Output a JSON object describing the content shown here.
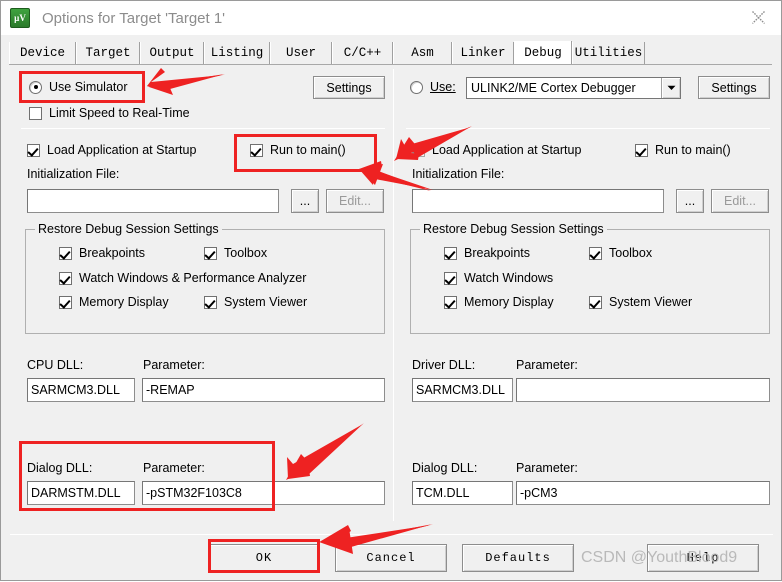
{
  "window": {
    "title": "Options for Target 'Target 1'",
    "app_icon_label": "µV",
    "close_label": "✕"
  },
  "tabs": [
    {
      "label": "Device",
      "active": false
    },
    {
      "label": "Target",
      "active": false
    },
    {
      "label": "Output",
      "active": false
    },
    {
      "label": "Listing",
      "active": false
    },
    {
      "label": "User",
      "active": false
    },
    {
      "label": "C/C++",
      "active": false
    },
    {
      "label": "Asm",
      "active": false
    },
    {
      "label": "Linker",
      "active": false
    },
    {
      "label": "Debug",
      "active": true
    },
    {
      "label": "Utilities",
      "active": false
    }
  ],
  "left": {
    "use_simulator_label": "Use Simulator",
    "use_simulator_checked": true,
    "limit_speed_label": "Limit Speed to Real-Time",
    "limit_speed_checked": false,
    "settings_button": "Settings",
    "load_app_label": "Load Application at Startup",
    "load_app_checked": true,
    "run_to_main_label": "Run to main()",
    "run_to_main_checked": true,
    "init_file_label": "Initialization File:",
    "init_file_value": "",
    "browse_button": "...",
    "edit_button": "Edit...",
    "restore_group_title": "Restore Debug Session Settings",
    "restore_items": [
      {
        "label": "Breakpoints",
        "checked": true
      },
      {
        "label": "Toolbox",
        "checked": true
      },
      {
        "label": "Watch Windows & Performance Analyzer",
        "checked": true
      },
      {
        "label": "Memory Display",
        "checked": true
      },
      {
        "label": "System Viewer",
        "checked": true
      }
    ],
    "cpu_dll_label": "CPU DLL:",
    "cpu_dll_value": "SARMCM3.DLL",
    "cpu_param_label": "Parameter:",
    "cpu_param_value": "-REMAP",
    "dialog_dll_label": "Dialog DLL:",
    "dialog_dll_value": "DARMSTM.DLL",
    "dialog_param_label": "Parameter:",
    "dialog_param_value": "-pSTM32F103C8"
  },
  "right": {
    "use_label": "Use:",
    "use_checked": false,
    "debugger_selected": "ULINK2/ME Cortex Debugger",
    "settings_button": "Settings",
    "load_app_label": "Load Application at Startup",
    "load_app_checked": true,
    "run_to_main_label": "Run to main()",
    "run_to_main_checked": true,
    "init_file_label": "Initialization File:",
    "init_file_value": "",
    "browse_button": "...",
    "edit_button": "Edit...",
    "restore_group_title": "Restore Debug Session Settings",
    "restore_items": [
      {
        "label": "Breakpoints",
        "checked": true
      },
      {
        "label": "Toolbox",
        "checked": true
      },
      {
        "label": "Watch Windows",
        "checked": true
      },
      {
        "label": "Memory Display",
        "checked": true
      },
      {
        "label": "System Viewer",
        "checked": true
      }
    ],
    "driver_dll_label": "Driver DLL:",
    "driver_dll_value": "SARMCM3.DLL",
    "driver_param_label": "Parameter:",
    "driver_param_value": "",
    "dialog_dll_label": "Dialog DLL:",
    "dialog_dll_value": "TCM.DLL",
    "dialog_param_label": "Parameter:",
    "dialog_param_value": "-pCM3"
  },
  "footer": {
    "ok_label": "OK",
    "cancel_label": "Cancel",
    "defaults_label": "Defaults",
    "help_label": "Help"
  },
  "watermark": {
    "text": "CSDN @YouthBlood9"
  },
  "annotation": {
    "color": "#ee2222"
  }
}
